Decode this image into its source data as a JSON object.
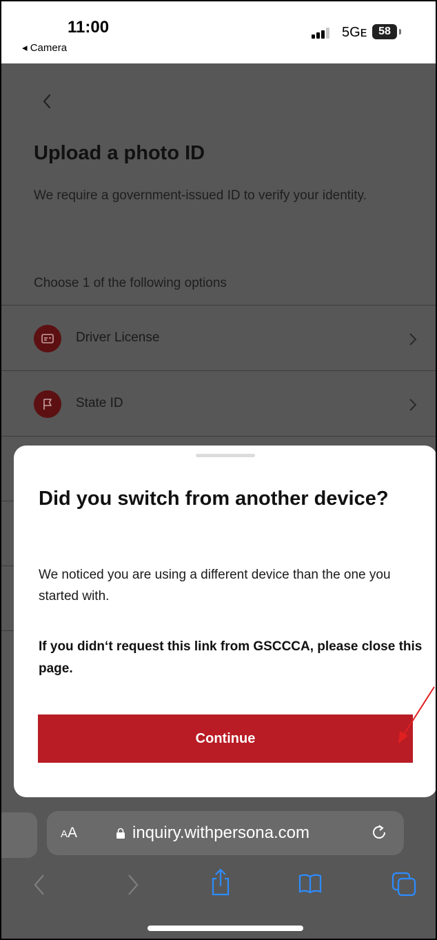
{
  "status_bar": {
    "time": "11:00",
    "back_app": "◂ Camera",
    "network": "5Gᴇ",
    "battery": "58"
  },
  "page": {
    "title": "Upload a photo ID",
    "description": "We require a government-issued ID to verify your identity.",
    "choose_label": "Choose 1 of the following options",
    "options": [
      {
        "label": "Driver License",
        "icon": "id-card-icon"
      },
      {
        "label": "State ID",
        "icon": "flag-icon"
      }
    ]
  },
  "sheet": {
    "title": "Did you switch from another device?",
    "body": "We noticed you are using a different device than the one you started with.",
    "warning": "If you didn‘t request this link from GSCCCA, please close this page.",
    "continue_label": "Continue"
  },
  "browser": {
    "aa_label_small": "A",
    "aa_label_large": "A",
    "url": "inquiry.withpersona.com"
  },
  "colors": {
    "accent": "#b91c25",
    "overlay": "#575757",
    "option_icon_bg": "#5c1012"
  }
}
